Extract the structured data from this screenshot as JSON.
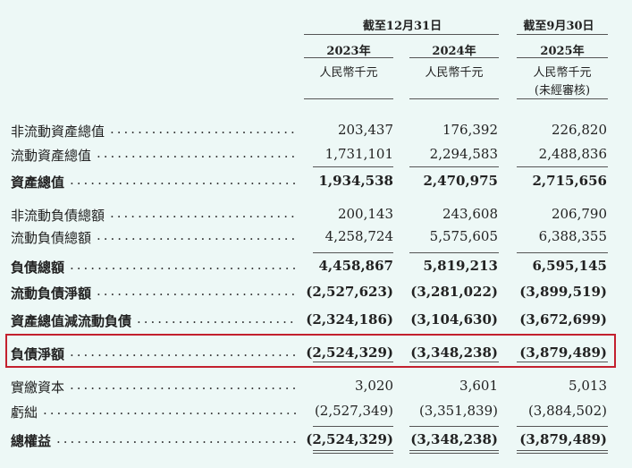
{
  "header": {
    "period_a": "截至12月31日",
    "period_b": "截至9月30日",
    "years": [
      "2023年",
      "2024年",
      "2025年"
    ],
    "units": [
      "人民幣千元",
      "人民幣千元",
      "人民幣千元"
    ],
    "audit_note": "(未經審核)"
  },
  "rows": [
    {
      "label": "非流動資產總值",
      "bold": false,
      "values": [
        "203,437",
        "176,392",
        "226,820"
      ]
    },
    {
      "label": "流動資產總值",
      "bold": false,
      "values": [
        "1,731,101",
        "2,294,583",
        "2,488,836"
      ]
    },
    {
      "label": "資產總值",
      "bold": true,
      "values": [
        "1,934,538",
        "2,470,975",
        "2,715,656"
      ]
    },
    {
      "label": "非流動負債總額",
      "bold": false,
      "values": [
        "200,143",
        "243,608",
        "206,790"
      ]
    },
    {
      "label": "流動負債總額",
      "bold": false,
      "values": [
        "4,258,724",
        "5,575,605",
        "6,388,355"
      ]
    },
    {
      "label": "負債總額",
      "bold": true,
      "values": [
        "4,458,867",
        "5,819,213",
        "6,595,145"
      ]
    },
    {
      "label": "流動負債淨額",
      "bold": true,
      "values": [
        "(2,527,623)",
        "(3,281,022)",
        "(3,899,519)"
      ]
    },
    {
      "label": "資產總值減流動負債",
      "bold": true,
      "values": [
        "(2,324,186)",
        "(3,104,630)",
        "(3,672,699)"
      ]
    },
    {
      "label": "負債淨額",
      "bold": true,
      "values": [
        "(2,524,329)",
        "(3,348,238)",
        "(3,879,489)"
      ]
    },
    {
      "label": "實繳資本",
      "bold": false,
      "values": [
        "3,020",
        "3,601",
        "5,013"
      ]
    },
    {
      "label": "虧絀",
      "bold": false,
      "values": [
        "(2,527,349)",
        "(3,351,839)",
        "(3,884,502)"
      ]
    },
    {
      "label": "總權益",
      "bold": true,
      "values": [
        "(2,524,329)",
        "(3,348,238)",
        "(3,879,489)"
      ]
    }
  ],
  "colors": {
    "highlight_border": "#c3202e",
    "background": "#edf8f6"
  }
}
